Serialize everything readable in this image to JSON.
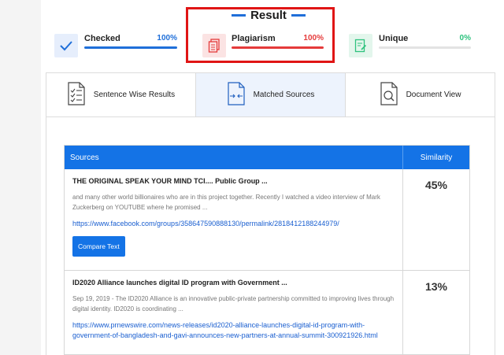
{
  "result": {
    "title": "Result",
    "stats": [
      {
        "label": "Checked",
        "percent": "100%",
        "progress": 1.0,
        "color": "#1f6fd9"
      },
      {
        "label": "Plagiarism",
        "percent": "100%",
        "progress": 1.0,
        "color": "#e53b3b"
      },
      {
        "label": "Unique",
        "percent": "0%",
        "progress": 0.0,
        "color": "#2ec27e"
      }
    ]
  },
  "tabs": [
    {
      "label": "Sentence Wise Results",
      "icon": "checklist-document-icon",
      "active": false
    },
    {
      "label": "Matched Sources",
      "icon": "arrows-document-icon",
      "active": true
    },
    {
      "label": "Document View",
      "icon": "magnifier-document-icon",
      "active": false
    }
  ],
  "table": {
    "headers": {
      "sources": "Sources",
      "similarity": "Similarity"
    },
    "rows": [
      {
        "title": "THE ORIGINAL SPEAK YOUR MIND TCI.... Public Group ...",
        "desc": "and many other world billionaires who are in this project together. Recently I watched a video interview of Mark Zuckerberg on YOUTUBE where he promised ...",
        "link": "https://www.facebook.com/groups/358647590888130/permalink/2818412188244979/",
        "similarity": "45%",
        "button": "Compare Text"
      },
      {
        "title": "ID2020 Alliance launches digital ID program with Government ...",
        "desc": "Sep 19, 2019 - The ID2020 Alliance is an innovative public-private partnership committed to improving lives through digital identity. ID2020 is coordinating ...",
        "link": "https://www.prnewswire.com/news-releases/id2020-alliance-launches-digital-id-program-with-government-of-bangladesh-and-gavi-announces-new-partners-at-annual-summit-300921926.html",
        "similarity": "13%"
      }
    ]
  }
}
